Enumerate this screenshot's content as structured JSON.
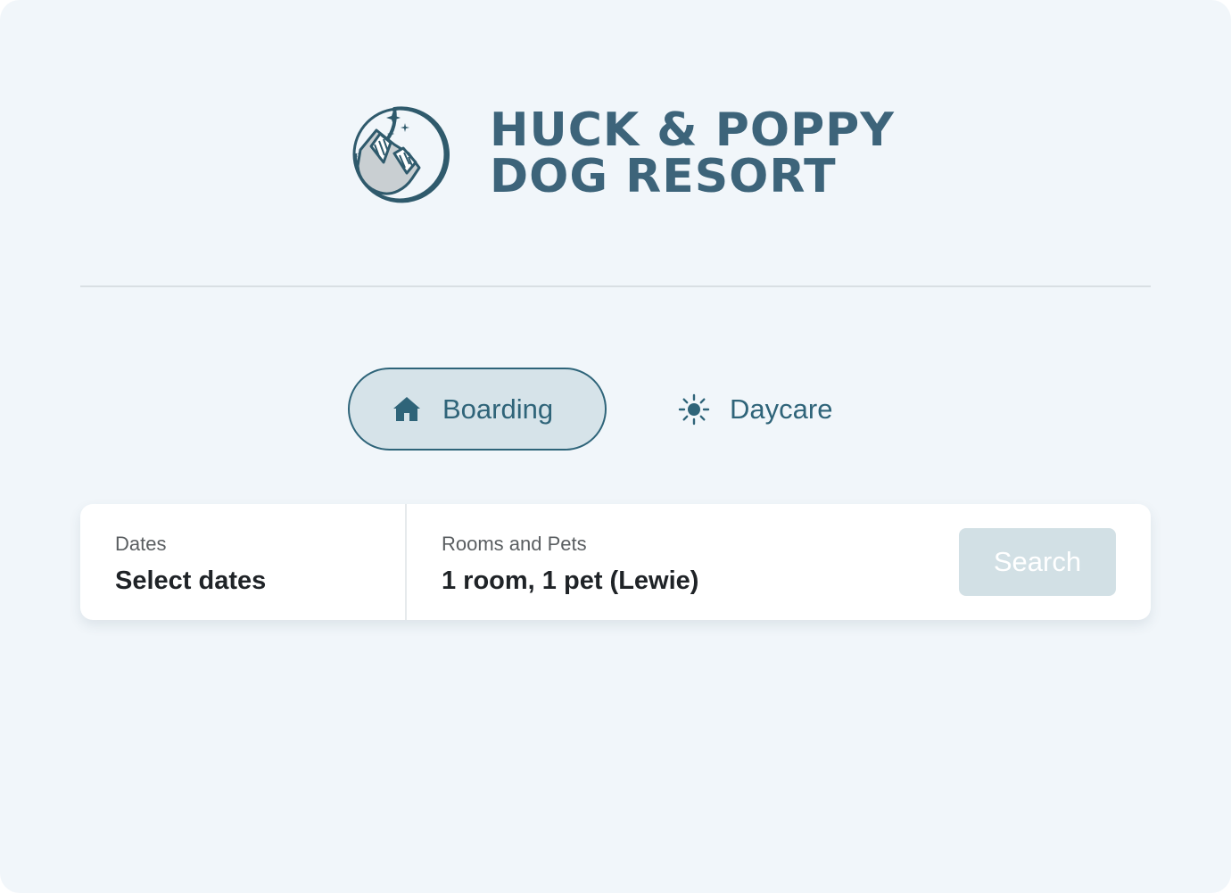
{
  "brand": {
    "line1": "HUCK & POPPY",
    "line2": "DOG RESORT",
    "logo_icon": "moon-dog-logo",
    "color": "#3d647a"
  },
  "tabs": [
    {
      "label": "Boarding",
      "icon": "house-icon",
      "selected": true
    },
    {
      "label": "Daycare",
      "icon": "sun-icon",
      "selected": false
    }
  ],
  "search": {
    "dates": {
      "label": "Dates",
      "value": "Select dates"
    },
    "rooms": {
      "label": "Rooms and Pets",
      "value": "1 room, 1 pet (Lewie)"
    },
    "button_label": "Search",
    "button_enabled": false
  },
  "colors": {
    "accent": "#2f6479",
    "background": "#f1f6fa",
    "selected_tab_fill": "#d6e3e9",
    "disabled_button": "#d2e0e5"
  }
}
